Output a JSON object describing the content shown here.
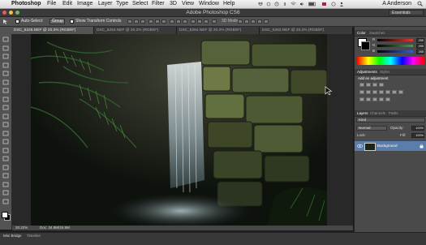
{
  "menubar": {
    "apple": "",
    "items": [
      "Photoshop",
      "File",
      "Edit",
      "Image",
      "Layer",
      "Type",
      "Select",
      "Filter",
      "3D",
      "View",
      "Window",
      "Help"
    ],
    "user": "A Anderson"
  },
  "titlebar": {
    "title": "Adobe Photoshop CS6",
    "workspace": "Essentials"
  },
  "options": {
    "auto_select": "Auto-Select:",
    "group": "Group",
    "transform": "Show Transform Controls",
    "mode3d": "3D Mode:"
  },
  "tabs": [
    {
      "label": "DSC_5225.NEF @ 20.2% (RGB/8*)",
      "active": true
    },
    {
      "label": "DSC_5254.NEF @ 20.2% (RGB/8*)",
      "active": false
    },
    {
      "label": "DSC_5264.NEF @ 20.2% (RGB/8*)",
      "active": false
    },
    {
      "label": "DSC_5283.NEF @ 20.2% (RGB/8*)",
      "active": false
    }
  ],
  "status": {
    "zoom": "20.22%",
    "doc": "Doc: 34.9M/34.9M"
  },
  "bottom": {
    "tabs": [
      "Mini Bridge",
      "Timeline"
    ]
  },
  "panels": {
    "color": {
      "tabs": [
        "Color",
        "Swatches"
      ],
      "sliders": [
        {
          "label": "R",
          "value": "255",
          "color": "#e23a2e"
        },
        {
          "label": "G",
          "value": "255",
          "color": "#3fa34a"
        },
        {
          "label": "B",
          "value": "255",
          "color": "#3a5fd0"
        }
      ]
    },
    "adjust": {
      "tabs": [
        "Adjustments",
        "Styles"
      ],
      "heading": "Add an adjustment"
    },
    "layers": {
      "tabs": [
        "Layers",
        "Channels",
        "Paths"
      ],
      "kind": "Kind",
      "blend": "Normal",
      "opacity_label": "Opacity:",
      "opacity": "100%",
      "lock": "Lock:",
      "fill_label": "Fill:",
      "fill": "100%",
      "layer_name": "Background"
    }
  },
  "colors": {
    "accent": "#2e5d9c",
    "chrome": "#535353",
    "panel_bg": "#4a4a4a"
  }
}
